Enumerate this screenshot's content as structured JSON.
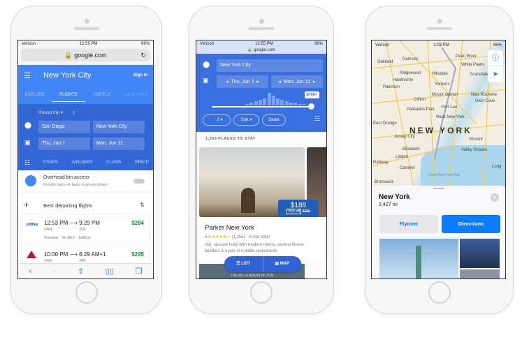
{
  "phone1": {
    "status": {
      "carrier": "Verizon",
      "time": "12:55 PM",
      "battery": "96%"
    },
    "url": "google.com",
    "header": {
      "title": "New York City",
      "sign_in": "Sign in"
    },
    "tabs": [
      "EXPLORE",
      "FLIGHTS",
      "HOTELS",
      "YOUR TRIPS"
    ],
    "trip_type": "Round trip",
    "passengers": "1",
    "origin": "San Diego",
    "destination": "New York City",
    "depart": "Thu, Jun 7",
    "return": "Mon, Jun 11",
    "filters": [
      "STOPS",
      "AIRLINES",
      "CLASS",
      "PRICE"
    ],
    "bin": {
      "title": "Overhead bin access",
      "subtitle": "Include carry-on bags in prices shown"
    },
    "section_title": "Best departing flights",
    "flights": [
      {
        "airline_logo": "jetBlue",
        "depart": "12:53 PM",
        "arrive": "9:29 PM",
        "from": "SAN",
        "to": "JFK",
        "details": "Nonstop · 5h 36m · JetBlue",
        "price": "$284"
      },
      {
        "airline_logo": "delta",
        "depart": "10:00 PM",
        "arrive": "6:29 AM+1",
        "from": "SAN",
        "to": "JFK",
        "price": "$295"
      }
    ]
  },
  "phone2": {
    "status": {
      "carrier": "Verizon",
      "time": "12:55 PM",
      "battery": "96%"
    },
    "url": "google.com",
    "location": "New York City",
    "checkin": "Thu, Jun 7",
    "checkout": "Mon, Jun 11",
    "price_max": "$700+",
    "histogram": [
      1,
      2,
      3,
      4,
      5,
      9,
      7,
      5,
      4,
      3,
      2,
      2,
      1,
      1
    ],
    "chips": {
      "guests": "2",
      "sort": "Sort",
      "deals": "Deals"
    },
    "count": "1,203 PLACES TO STAY",
    "hotel": {
      "name": "Parker New York",
      "rating": "4.3",
      "stars": 4.3,
      "reviews": "(1,255)",
      "class": "4-star hotel",
      "description": "Hip, upscale hotel with modern rooms, several fitness facilities & a pair of notable restaurants.",
      "price": "$188",
      "discount": "35% off",
      "old_price": "$290"
    },
    "next_hotel_sign": "THE MILLENNIUM HILTON",
    "toggle": {
      "list": "LIST",
      "map": "MAP"
    }
  },
  "phone3": {
    "status": {
      "carrier": "Verizon",
      "time": "1:03 PM",
      "battery": "95%"
    },
    "map_labels": [
      "Oakland",
      "Ramsey",
      "Pearl River",
      "White Plains",
      "Ridgewood",
      "Hillsdale",
      "Scarsdale",
      "Hawthorne",
      "Paterson",
      "Yonkers",
      "Mount Vernon",
      "New Rochelle",
      "Glen Cove",
      "Clifton",
      "Palisades Park",
      "Fort Lee",
      "West New York",
      "East Orange",
      "NEW YORK",
      "Jersey City",
      "Elizabeth",
      "Elmont",
      "Valley Stream",
      "Linden",
      "Rahway",
      "Carteret",
      "Lower New York Bay",
      "Brunswick",
      "Long"
    ],
    "place": {
      "name": "New York",
      "distance": "2,427 mi"
    },
    "buttons": {
      "flyover": "Flyover",
      "directions": "Directions"
    }
  },
  "colors": {
    "google_blue": "#4285f4",
    "google_dark_blue": "#3367d6",
    "price_green": "#1e8e3e",
    "ios_blue": "#007aff"
  }
}
